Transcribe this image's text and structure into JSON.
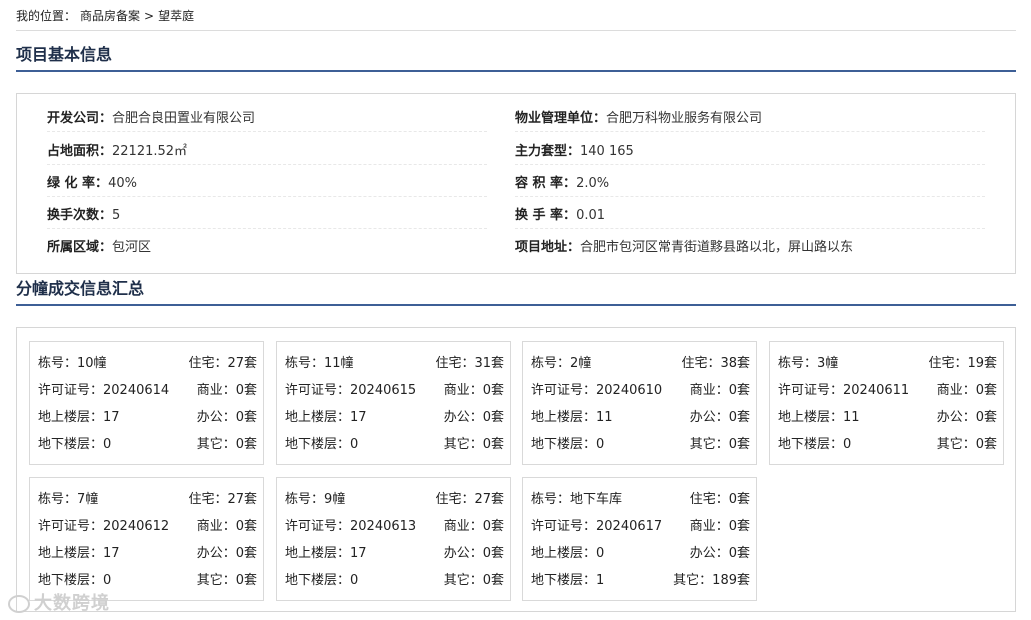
{
  "breadcrumb": {
    "prefix": "我的位置：",
    "link": "商品房备案",
    "sep": ">",
    "current": "望萃庭"
  },
  "section1_title": "项目基本信息",
  "section2_title": "分幢成交信息汇总",
  "basic": {
    "developer": {
      "k": "开发公司：",
      "v": "合肥合良田置业有限公司"
    },
    "property_mgmt": {
      "k": "物业管理单位：",
      "v": "合肥万科物业服务有限公司"
    },
    "land_area": {
      "k": "占地面积：",
      "v": "22121.52㎡"
    },
    "main_unit": {
      "k": "主力套型：",
      "v": "140 165"
    },
    "green_rate": {
      "k": "绿 化 率：",
      "v": "40%"
    },
    "plot_ratio": {
      "k": "容 积 率：",
      "v": "2.0%"
    },
    "turnover_times": {
      "k": "换手次数：",
      "v": "5"
    },
    "turnover_rate": {
      "k": "换 手 率：",
      "v": "0.01"
    },
    "district": {
      "k": "所属区域：",
      "v": "包河区"
    },
    "address": {
      "k": "项目地址：",
      "v": "合肥市包河区常青街道黟县路以北，屏山路以东"
    }
  },
  "cards": [
    {
      "l1": "栋号：10幢",
      "r1": "住宅：27套",
      "l2": "许可证号：20240614",
      "r2": "商业：0套",
      "l3": "地上楼层：17",
      "r3": "办公：0套",
      "l4": "地下楼层：0",
      "r4": "其它：0套"
    },
    {
      "l1": "栋号：11幢",
      "r1": "住宅：31套",
      "l2": "许可证号：20240615",
      "r2": "商业：0套",
      "l3": "地上楼层：17",
      "r3": "办公：0套",
      "l4": "地下楼层：0",
      "r4": "其它：0套"
    },
    {
      "l1": "栋号：2幢",
      "r1": "住宅：38套",
      "l2": "许可证号：20240610",
      "r2": "商业：0套",
      "l3": "地上楼层：11",
      "r3": "办公：0套",
      "l4": "地下楼层：0",
      "r4": "其它：0套"
    },
    {
      "l1": "栋号：3幢",
      "r1": "住宅：19套",
      "l2": "许可证号：20240611",
      "r2": "商业：0套",
      "l3": "地上楼层：11",
      "r3": "办公：0套",
      "l4": "地下楼层：0",
      "r4": "其它：0套"
    },
    {
      "l1": "栋号：7幢",
      "r1": "住宅：27套",
      "l2": "许可证号：20240612",
      "r2": "商业：0套",
      "l3": "地上楼层：17",
      "r3": "办公：0套",
      "l4": "地下楼层：0",
      "r4": "其它：0套"
    },
    {
      "l1": "栋号：9幢",
      "r1": "住宅：27套",
      "l2": "许可证号：20240613",
      "r2": "商业：0套",
      "l3": "地上楼层：17",
      "r3": "办公：0套",
      "l4": "地下楼层：0",
      "r4": "其它：0套"
    },
    {
      "l1": "栋号：地下车库",
      "r1": "住宅：0套",
      "l2": "许可证号：20240617",
      "r2": "商业：0套",
      "l3": "地上楼层：0",
      "r3": "办公：0套",
      "l4": "地下楼层：1",
      "r4": "其它：189套"
    }
  ],
  "watermark": "大数跨境"
}
